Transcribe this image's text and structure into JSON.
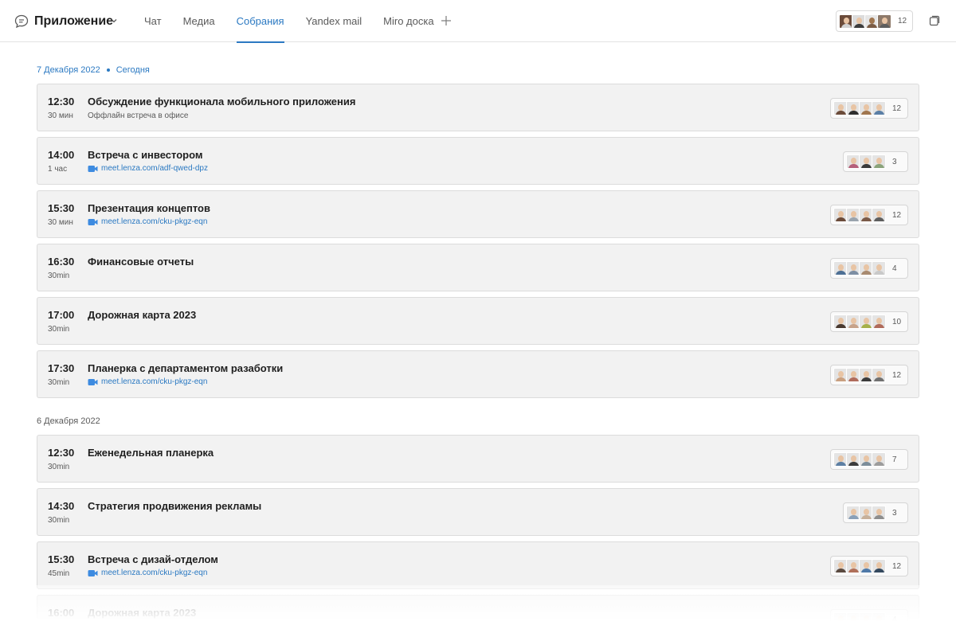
{
  "header": {
    "app_title": "Приложение",
    "app_icon": "chat-bubble-icon",
    "tabs": [
      {
        "label": "Чат",
        "active": false
      },
      {
        "label": "Медиа",
        "active": false
      },
      {
        "label": "Собрания",
        "active": true
      },
      {
        "label": "Yandex mail",
        "active": false
      },
      {
        "label": "Miro доска",
        "active": false
      }
    ],
    "participants_count": "12",
    "accent_color": "#2b79c2"
  },
  "sections": [
    {
      "date": "7 Декабря 2022",
      "today_label": "Сегодня",
      "meetings": [
        {
          "time": "12:30",
          "duration": "30 мин",
          "title": "Обсуждение функционала мобильного приложения",
          "subtitle": "Оффлайн встреча в офисе",
          "link": "",
          "count": "12",
          "avatars": [
            "#6b4b3a",
            "#2e2e2e",
            "#a0764f",
            "#5b7fa6"
          ]
        },
        {
          "time": "14:00",
          "duration": "1 час",
          "title": "Встреча с инвестором",
          "subtitle": "",
          "link": "meet.lenza.com/adf-qwed-dpz",
          "count": "3",
          "avatars": [
            "#b5607a",
            "#3a3a3a",
            "#8aa37a"
          ]
        },
        {
          "time": "15:30",
          "duration": "30 мин",
          "title": "Презентация концептов",
          "subtitle": "",
          "link": "meet.lenza.com/cku-pkgz-eqn",
          "count": "12",
          "avatars": [
            "#6b4b3a",
            "#9aa4ae",
            "#7a5a48",
            "#5e5e5e"
          ]
        },
        {
          "time": "16:30",
          "duration": "30min",
          "title": "Финансовые отчеты",
          "subtitle": "",
          "link": "",
          "count": "4",
          "avatars": [
            "#4d6f94",
            "#7d8ea3",
            "#a88a70",
            "#c9c9c9"
          ]
        },
        {
          "time": "17:00",
          "duration": "30min",
          "title": "Дорожная карта 2023",
          "subtitle": "",
          "link": "",
          "count": "10",
          "avatars": [
            "#4a3a30",
            "#c7a38a",
            "#a6b04a",
            "#b06a5a"
          ]
        },
        {
          "time": "17:30",
          "duration": "30min",
          "title": "Планерка с департаментом разаботки",
          "subtitle": "",
          "link": "meet.lenza.com/cku-pkgz-eqn",
          "count": "12",
          "avatars": [
            "#c9a080",
            "#b06c5c",
            "#3b3b3b",
            "#707070"
          ]
        }
      ]
    },
    {
      "date": "6 Декабря 2022",
      "today_label": "",
      "meetings": [
        {
          "time": "12:30",
          "duration": "30min",
          "title": "Еженедельная планерка",
          "subtitle": "",
          "link": "",
          "count": "7",
          "avatars": [
            "#5d7fa3",
            "#3c3c3c",
            "#7c8d9a",
            "#9c9c9c"
          ]
        },
        {
          "time": "14:30",
          "duration": "30min",
          "title": "Стратегия продвижения рекламы",
          "subtitle": "",
          "link": "",
          "count": "3",
          "avatars": [
            "#8aa0b8",
            "#c7b09a",
            "#8e8e8e"
          ]
        },
        {
          "time": "15:30",
          "duration": "45min",
          "title": "Встреча с дизай-отделом",
          "subtitle": "",
          "link": "meet.lenza.com/cku-pkgz-eqn",
          "count": "12",
          "avatars": [
            "#5a4a40",
            "#b0705a",
            "#4f79a8",
            "#34495e"
          ]
        },
        {
          "time": "16:00",
          "duration": "",
          "title": "Дорожная карта 2023",
          "subtitle": "",
          "link": "",
          "count": "4",
          "avatars": [
            "#8a8a8a",
            "#a0a0a0",
            "#9a9a9a",
            "#b0b0b0"
          ]
        }
      ]
    }
  ]
}
